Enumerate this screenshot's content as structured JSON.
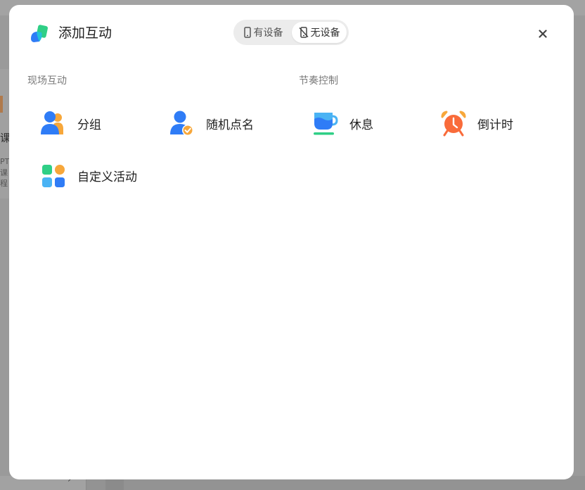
{
  "background": {
    "card_text_1": "课",
    "card_text_2": "PT",
    "card_text_3": "课程",
    "bottom_chevron": "›"
  },
  "modal": {
    "title": "添加互动",
    "close_glyph": "✕",
    "mode_toggle": {
      "options": [
        {
          "label": "有设备",
          "icon": "phone-icon",
          "selected": false
        },
        {
          "label": "无设备",
          "icon": "no-phone-icon",
          "selected": true
        }
      ]
    },
    "sections": {
      "live": {
        "label": "现场互动",
        "items": [
          {
            "label": "分组",
            "icon": "group-icon"
          },
          {
            "label": "随机点名",
            "icon": "random-call-icon"
          },
          {
            "label": "自定义活动",
            "icon": "custom-activity-icon"
          }
        ]
      },
      "rhythm": {
        "label": "节奏控制",
        "items": [
          {
            "label": "休息",
            "icon": "coffee-cup-icon"
          },
          {
            "label": "倒计时",
            "icon": "alarm-clock-icon"
          }
        ]
      }
    }
  },
  "colors": {
    "primary_blue": "#2f7cf6",
    "accent_orange": "#f7a73a",
    "accent_green": "#2fcf86",
    "clock_orange": "#f96b3a"
  }
}
